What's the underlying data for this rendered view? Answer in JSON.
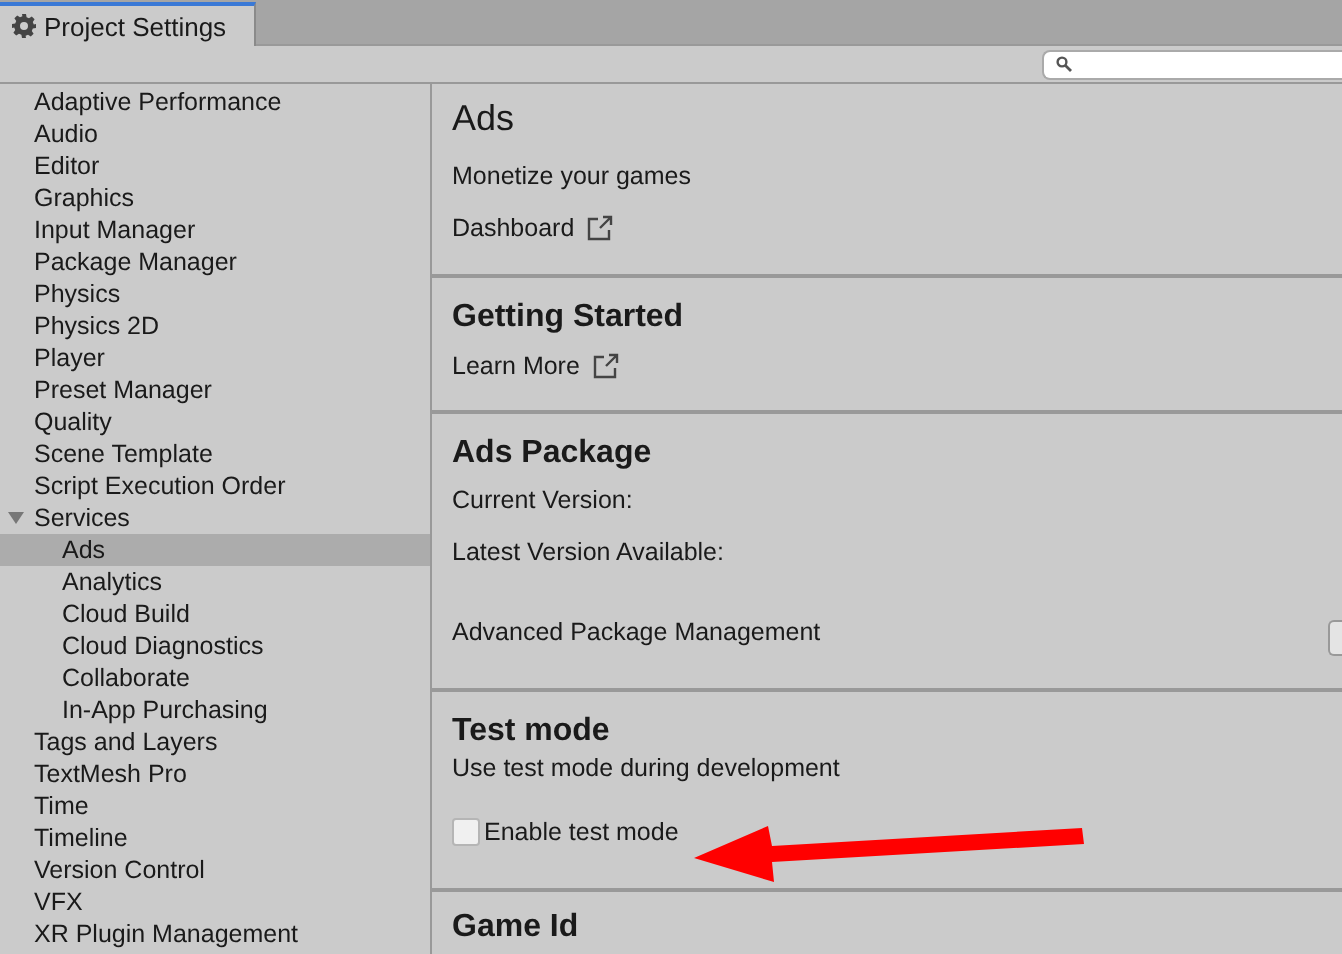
{
  "window": {
    "tab": "Project Settings"
  },
  "sidebar": {
    "items": [
      {
        "label": "Adaptive Performance",
        "selected": false
      },
      {
        "label": "Audio",
        "selected": false
      },
      {
        "label": "Editor",
        "selected": false
      },
      {
        "label": "Graphics",
        "selected": false
      },
      {
        "label": "Input Manager",
        "selected": false
      },
      {
        "label": "Package Manager",
        "selected": false
      },
      {
        "label": "Physics",
        "selected": false
      },
      {
        "label": "Physics 2D",
        "selected": false
      },
      {
        "label": "Player",
        "selected": false
      },
      {
        "label": "Preset Manager",
        "selected": false
      },
      {
        "label": "Quality",
        "selected": false
      },
      {
        "label": "Scene Template",
        "selected": false
      },
      {
        "label": "Script Execution Order",
        "selected": false
      },
      {
        "label": "Services",
        "selected": false,
        "expanded": true,
        "children": [
          {
            "label": "Ads",
            "selected": true
          },
          {
            "label": "Analytics",
            "selected": false
          },
          {
            "label": "Cloud Build",
            "selected": false
          },
          {
            "label": "Cloud Diagnostics",
            "selected": false
          },
          {
            "label": "Collaborate",
            "selected": false
          },
          {
            "label": "In-App Purchasing",
            "selected": false
          }
        ]
      },
      {
        "label": "Tags and Layers",
        "selected": false
      },
      {
        "label": "TextMesh Pro",
        "selected": false
      },
      {
        "label": "Time",
        "selected": false
      },
      {
        "label": "Timeline",
        "selected": false
      },
      {
        "label": "Version Control",
        "selected": false
      },
      {
        "label": "VFX",
        "selected": false
      },
      {
        "label": "XR Plugin Management",
        "selected": false
      }
    ]
  },
  "sections": [
    {
      "kind": "page_title",
      "title": "Ads",
      "description": "Monetize your games",
      "link": "Dashboard"
    },
    {
      "kind": "section",
      "title": "Getting Started",
      "link": "Learn More"
    },
    {
      "kind": "section",
      "title": "Ads Package",
      "fields": [
        "Current Version:",
        "Latest Version Available:"
      ],
      "action_label": "Advanced Package Management"
    },
    {
      "kind": "section",
      "title": "Test mode",
      "description": "Use test mode during development",
      "checkbox": {
        "label": "Enable test mode",
        "checked": false
      }
    },
    {
      "kind": "section",
      "title": "Game Id"
    }
  ]
}
